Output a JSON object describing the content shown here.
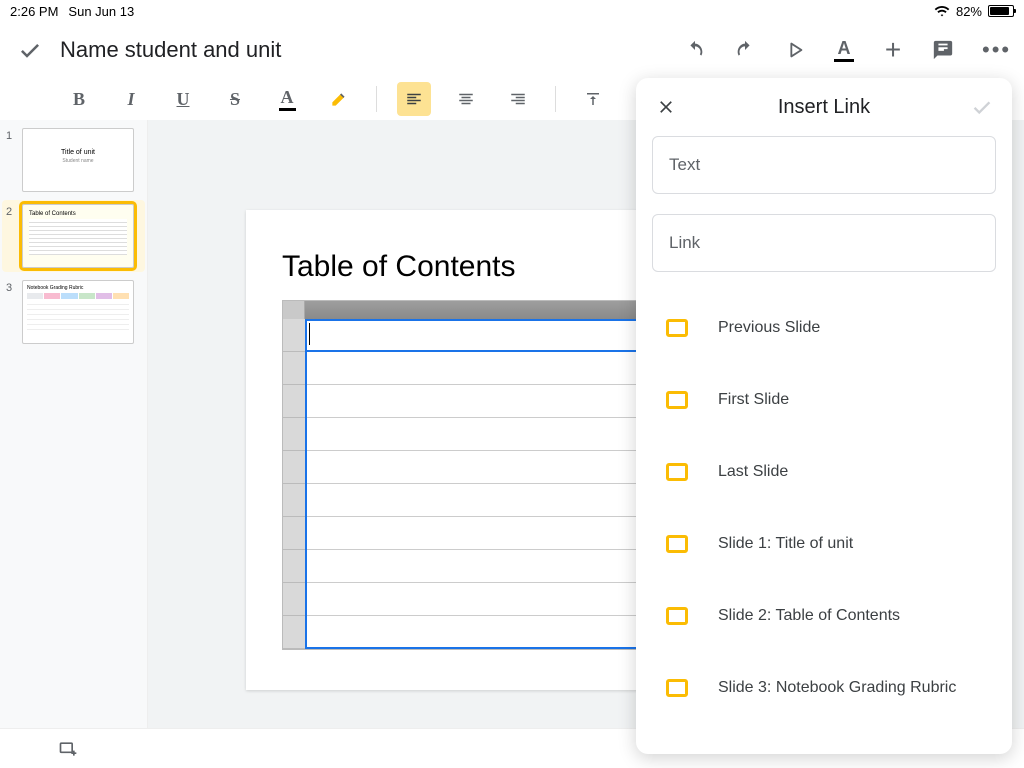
{
  "status": {
    "time": "2:26 PM",
    "date": "Sun Jun 13",
    "battery_pct": "82%"
  },
  "doc": {
    "title": "Name student and unit"
  },
  "toolbar": {
    "bold": "B",
    "italic": "I",
    "underline": "U",
    "strike": "S",
    "textcolor": "A"
  },
  "thumbs": [
    {
      "num": "1",
      "title": "Title of unit",
      "subtitle": "Student name"
    },
    {
      "num": "2",
      "title": "Table of Contents"
    },
    {
      "num": "3",
      "title": "Notebook Grading Rubric"
    }
  ],
  "slide": {
    "title": "Table of Contents"
  },
  "panel": {
    "title": "Insert Link",
    "text_placeholder": "Text",
    "link_placeholder": "Link",
    "options": [
      "Previous Slide",
      "First Slide",
      "Last Slide",
      "Slide 1: Title of unit",
      "Slide 2: Table of Contents",
      "Slide 3: Notebook Grading Rubric"
    ]
  }
}
